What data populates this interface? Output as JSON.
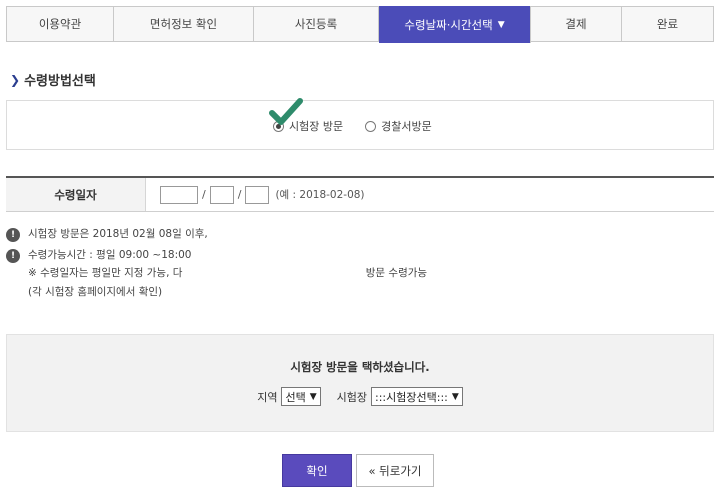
{
  "steps": [
    {
      "label": "이용약관"
    },
    {
      "label": "면허정보 확인"
    },
    {
      "label": "사진등록"
    },
    {
      "label": "수령날짜·시간선택"
    },
    {
      "label": "결제"
    },
    {
      "label": "완료"
    }
  ],
  "active_step_index": 3,
  "section_title": "수령방법선택",
  "method": {
    "options": [
      {
        "label": "시험장 방문",
        "selected": true
      },
      {
        "label": "경찰서방문",
        "selected": false
      }
    ]
  },
  "date": {
    "label": "수령일자",
    "hint": "(예 : 2018-02-08)",
    "separator": "/"
  },
  "notices": {
    "line1": "시험장 방문은 2018년 02월 08일 이후,",
    "line2": "수령가능시간 : 평일 09:00 ~18:00",
    "line3": "※ 수령일자는 평일만 지정 가능, 다",
    "line3_tail": "방문 수령가능",
    "line4": "(각 시험장 홈페이지에서 확인)"
  },
  "select_panel": {
    "title": "시험장 방문을 택하셨습니다.",
    "region_label": "지역",
    "region_value": "선택",
    "center_label": "시험장",
    "center_value": ":::시험장선택:::"
  },
  "buttons": {
    "ok": "확인",
    "back": "« 뒤로가기"
  },
  "colors": {
    "active_tab": "#4b4cb8",
    "ok_button": "#5a4bbd",
    "check_mark": "#2e8b6b"
  }
}
